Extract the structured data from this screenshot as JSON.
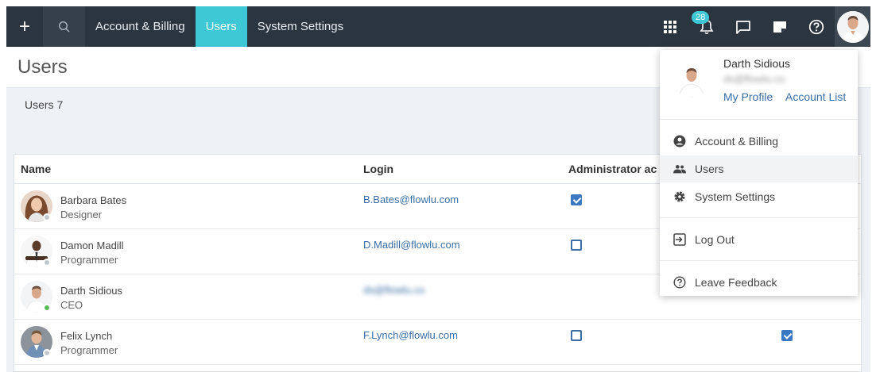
{
  "nav": {
    "plus": "+",
    "links": [
      "Account & Billing",
      "Users",
      "System Settings"
    ],
    "active_link": "Users",
    "notification_count": "28"
  },
  "page": {
    "title": "Users",
    "users_count": "Users 7"
  },
  "table": {
    "headers": {
      "name": "Name",
      "login": "Login",
      "admin": "Administrator ac"
    },
    "rows": [
      {
        "name": "Barbara Bates",
        "role": "Designer",
        "login": "B.Bates@flowlu.com",
        "online": false,
        "admin": true,
        "other": null
      },
      {
        "name": "Damon Madill",
        "role": "Programmer",
        "login": "D.Madill@flowlu.com",
        "online": false,
        "admin": false,
        "other": null
      },
      {
        "name": "Darth Sidious",
        "role": "CEO",
        "login": "ds@flowlu.co",
        "online": true,
        "admin": null,
        "other": null
      },
      {
        "name": "Felix Lynch",
        "role": "Programmer",
        "login": "F.Lynch@flowlu.com",
        "online": false,
        "admin": false,
        "other": true
      }
    ]
  },
  "dropdown": {
    "name": "Darth Sidious",
    "email": "ds@flowlu.co",
    "my_profile": "My Profile",
    "account_list": "Account List",
    "items": [
      {
        "label": "Account & Billing",
        "icon": "account-circle-icon"
      },
      {
        "label": "Users",
        "icon": "users-icon"
      },
      {
        "label": "System Settings",
        "icon": "gear-icon"
      },
      {
        "label": "Log Out",
        "icon": "logout-icon"
      },
      {
        "label": "Leave Feedback",
        "icon": "help-icon"
      }
    ]
  },
  "colors": {
    "nav_bg": "#2b3540",
    "accent": "#3ec7d4",
    "link": "#3a6ea5",
    "checkbox": "#3a78c2",
    "online": "#5cb85c"
  }
}
